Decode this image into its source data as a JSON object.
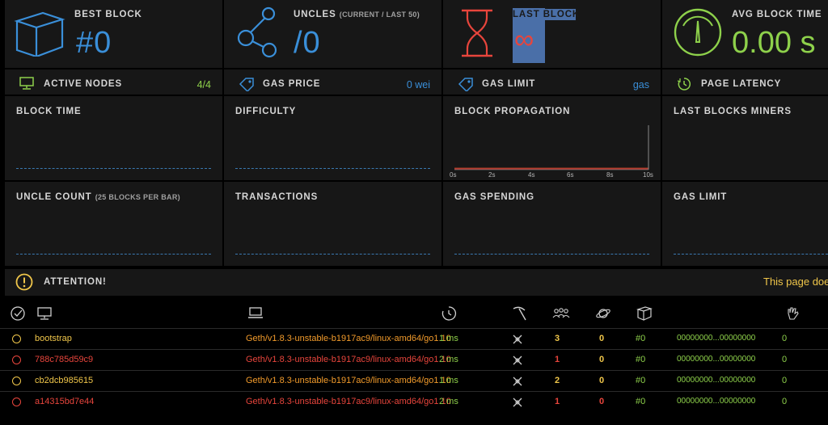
{
  "colors": {
    "blue": "#3a8fd9",
    "red": "#e8453c",
    "green": "#8ed14b",
    "yellow": "#f0c64a",
    "orange": "#f29b2b",
    "label": "#d6d6d6",
    "panel": "#171717"
  },
  "top_cards": {
    "best_block": {
      "label": "Best Block",
      "value": "#0",
      "icon": "cube-icon"
    },
    "uncles": {
      "label": "Uncles",
      "sub_label": "(Current / Last 50)",
      "value": "/0",
      "icon": "molecule-icon"
    },
    "last_block": {
      "label": "Last Block",
      "value": "∞",
      "icon": "hourglass-icon"
    },
    "avg_block_time": {
      "label": "Avg Block Time",
      "value": "0.00 s",
      "icon": "gauge-icon"
    }
  },
  "stats": {
    "active_nodes": {
      "label": "Active Nodes",
      "value": "4/4",
      "icon": "monitor-icon"
    },
    "gas_price": {
      "label": "Gas Price",
      "value": "0 wei",
      "icon": "tag-icon"
    },
    "gas_limit": {
      "label": "Gas Limit",
      "value": "gas",
      "icon": "tag-icon"
    },
    "page_latency": {
      "label": "Page Latency",
      "value": "",
      "icon": "timer-icon"
    }
  },
  "charts": {
    "block_time": {
      "title": "Block Time"
    },
    "difficulty": {
      "title": "Difficulty"
    },
    "block_propagation": {
      "title": "Block Propagation",
      "ticks": [
        "0s",
        "2s",
        "4s",
        "6s",
        "8s",
        "10s"
      ]
    },
    "last_blocks_miners": {
      "title": "Last Blocks Miners"
    },
    "uncle_count": {
      "title": "Uncle Count",
      "sub_title": "(25 Blocks Per Bar)"
    },
    "transactions": {
      "title": "Transactions"
    },
    "gas_spending": {
      "title": "Gas Spending"
    },
    "gas_limit": {
      "title": "Gas Limit"
    }
  },
  "attention": {
    "label": "Attention!",
    "message": "This page doe"
  },
  "table": {
    "header_icons": [
      "check-circle-icon",
      "monitor-icon",
      "laptop-icon",
      "timer-icon",
      "pickaxe-icon",
      "peers-icon",
      "planet-icon",
      "cube-icon",
      "stopwatch-icon",
      "hand-icon"
    ],
    "rows": [
      {
        "name": "bootstrap",
        "client": "Geth/v1.8.3-unstable-b1917ac9/linux-amd64/go1.10",
        "latency": "1 ms",
        "peers": "3",
        "pending": "0",
        "block": "#0",
        "hash": "00000000...00000000",
        "propagation": "0",
        "status": "yellow"
      },
      {
        "name": "788c785d59c9",
        "client": "Geth/v1.8.3-unstable-b1917ac9/linux-amd64/go1.10",
        "latency": "2 ms",
        "peers": "1",
        "pending": "0",
        "block": "#0",
        "hash": "00000000...00000000",
        "propagation": "0",
        "status": "red"
      },
      {
        "name": "cb2dcb985615",
        "client": "Geth/v1.8.3-unstable-b1917ac9/linux-amd64/go1.10",
        "latency": "1 ms",
        "peers": "2",
        "pending": "0",
        "block": "#0",
        "hash": "00000000...00000000",
        "propagation": "0",
        "status": "yellow"
      },
      {
        "name": "a14315bd7e44",
        "client": "Geth/v1.8.3-unstable-b1917ac9/linux-amd64/go1.10",
        "latency": "2 ms",
        "peers": "1",
        "pending": "0",
        "block": "#0",
        "hash": "00000000...00000000",
        "propagation": "0",
        "status": "red"
      }
    ]
  }
}
